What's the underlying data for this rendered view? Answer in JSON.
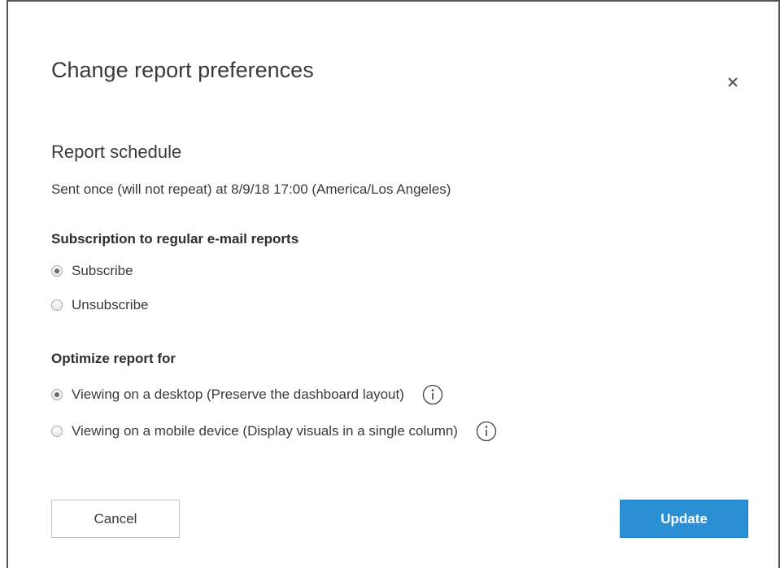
{
  "dialog": {
    "title": "Change report preferences",
    "close_icon": "close-icon"
  },
  "schedule": {
    "heading": "Report schedule",
    "description": "Sent once (will not repeat) at 8/9/18 17:00 (America/Los Angeles)"
  },
  "subscription": {
    "heading": "Subscription to regular e-mail reports",
    "options": [
      {
        "label": "Subscribe",
        "selected": true
      },
      {
        "label": "Unsubscribe",
        "selected": false
      }
    ]
  },
  "optimize": {
    "heading": "Optimize report for",
    "options": [
      {
        "label": "Viewing on a desktop (Preserve the dashboard layout)",
        "selected": true,
        "info_icon": "info-icon"
      },
      {
        "label": "Viewing on a mobile device (Display visuals in a single column)",
        "selected": false,
        "info_icon": "info-icon"
      }
    ]
  },
  "buttons": {
    "cancel_label": "Cancel",
    "update_label": "Update"
  },
  "colors": {
    "primary": "#2b8fd4",
    "text": "#3a3a3a",
    "border": "#555555"
  }
}
